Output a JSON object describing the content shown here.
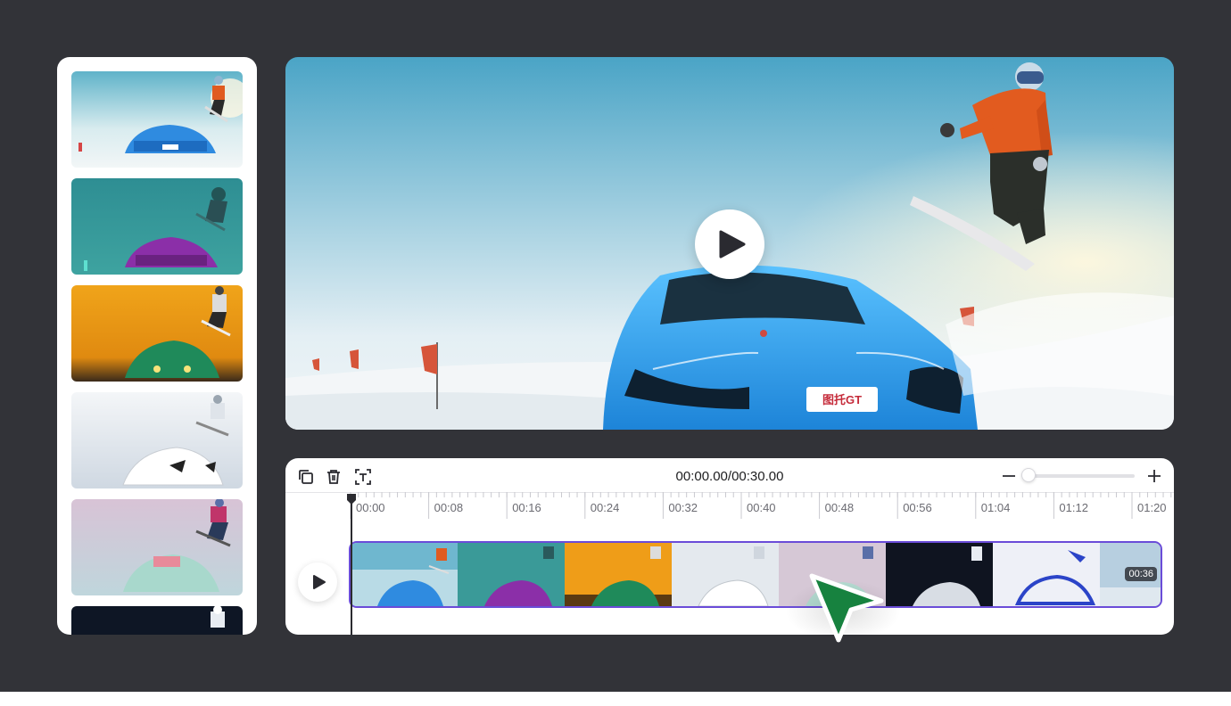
{
  "timeline": {
    "timecode": "00:00.00/00:30.00",
    "ticks": [
      "00:00",
      "00:08",
      "00:16",
      "00:24",
      "00:32",
      "00:40",
      "00:48",
      "00:56",
      "01:04",
      "01:12",
      "01:20"
    ],
    "clip_duration": "00:36",
    "zoom_level": 0.0
  },
  "preview": {
    "plate_text": "图托GT"
  },
  "colors": {
    "clip_border": "#6a4cd8",
    "cursor": "#17823f",
    "background": "#323338"
  },
  "icons": {
    "duplicate": "duplicate-icon",
    "delete": "trash-icon",
    "split": "split-text-icon",
    "play": "play-icon",
    "zoom_out": "minus-icon",
    "zoom_in": "plus-icon"
  }
}
